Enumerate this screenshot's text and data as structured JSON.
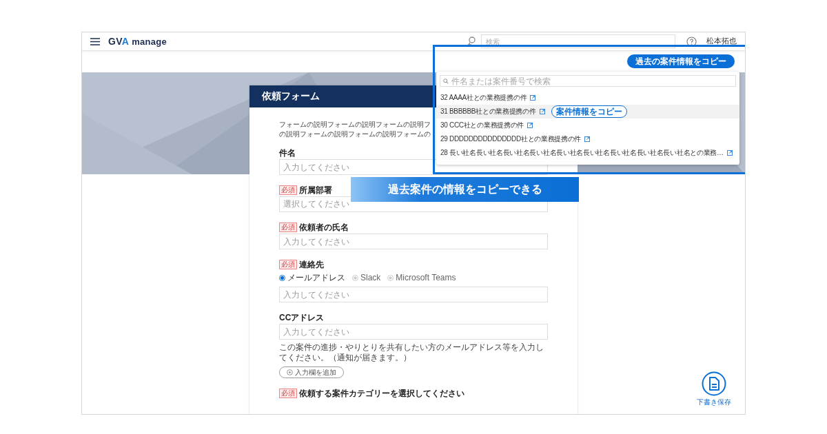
{
  "header": {
    "logo": {
      "main": "GV",
      "accent": "A",
      "suffix": "manage"
    },
    "search": {
      "placeholder": "検索"
    },
    "user": "松本拓也"
  },
  "copy_button": "過去の案件情報をコピー",
  "popup": {
    "search": {
      "placeholder": "件名または案件番号で検索"
    },
    "items": [
      {
        "title": "32 AAAA社との業務提携の件",
        "selected": false
      },
      {
        "title": "31 BBBBBB社との業務提携の件",
        "selected": true,
        "action": "案件情報をコピー"
      },
      {
        "title": "30 CCC社との業務提携の件",
        "selected": false
      },
      {
        "title": "29 DDDDDDDDDDDDDDD社との業務提携の件",
        "selected": false
      },
      {
        "title": "28 長い社名長い社名長い社名長い社名長い社名長い社名長い社名長い社名長い社名との業務…",
        "selected": false
      }
    ]
  },
  "form": {
    "title": "依頼フォーム",
    "description": [
      "フォームの説明フォームの説明フォームの説明フ",
      "の説明フォームの説明フォームの説明フォームの"
    ],
    "fields": [
      {
        "kind": "text",
        "label": "件名",
        "placeholder": "入力してください"
      },
      {
        "kind": "select",
        "label": "所属部署",
        "badge": "必須",
        "placeholder": "選択してください"
      },
      {
        "kind": "text",
        "label": "依頼者の氏名",
        "badge": "必須",
        "placeholder": "入力してください"
      },
      {
        "kind": "radio",
        "label": "連絡先",
        "badge": "必須",
        "options": [
          {
            "label": "メールアドレス",
            "selected": true
          },
          {
            "label": "Slack",
            "selected": false
          },
          {
            "label": "Microsoft Teams",
            "selected": false
          }
        ],
        "placeholder": "入力してください"
      },
      {
        "kind": "text",
        "label": "CCアドレス",
        "placeholder": "入力してください",
        "help": "この案件の進捗・やりとりを共有したい方のメールアドレス等を入力してください。（通知が届きます。）",
        "add_button": "入力欄を追加"
      },
      {
        "kind": "label",
        "label": "依頼する案件カテゴリーを選択してください",
        "badge": "必須"
      }
    ]
  },
  "banner": "過去案件の情報をコピーできる",
  "draft_button": "下書き保存"
}
